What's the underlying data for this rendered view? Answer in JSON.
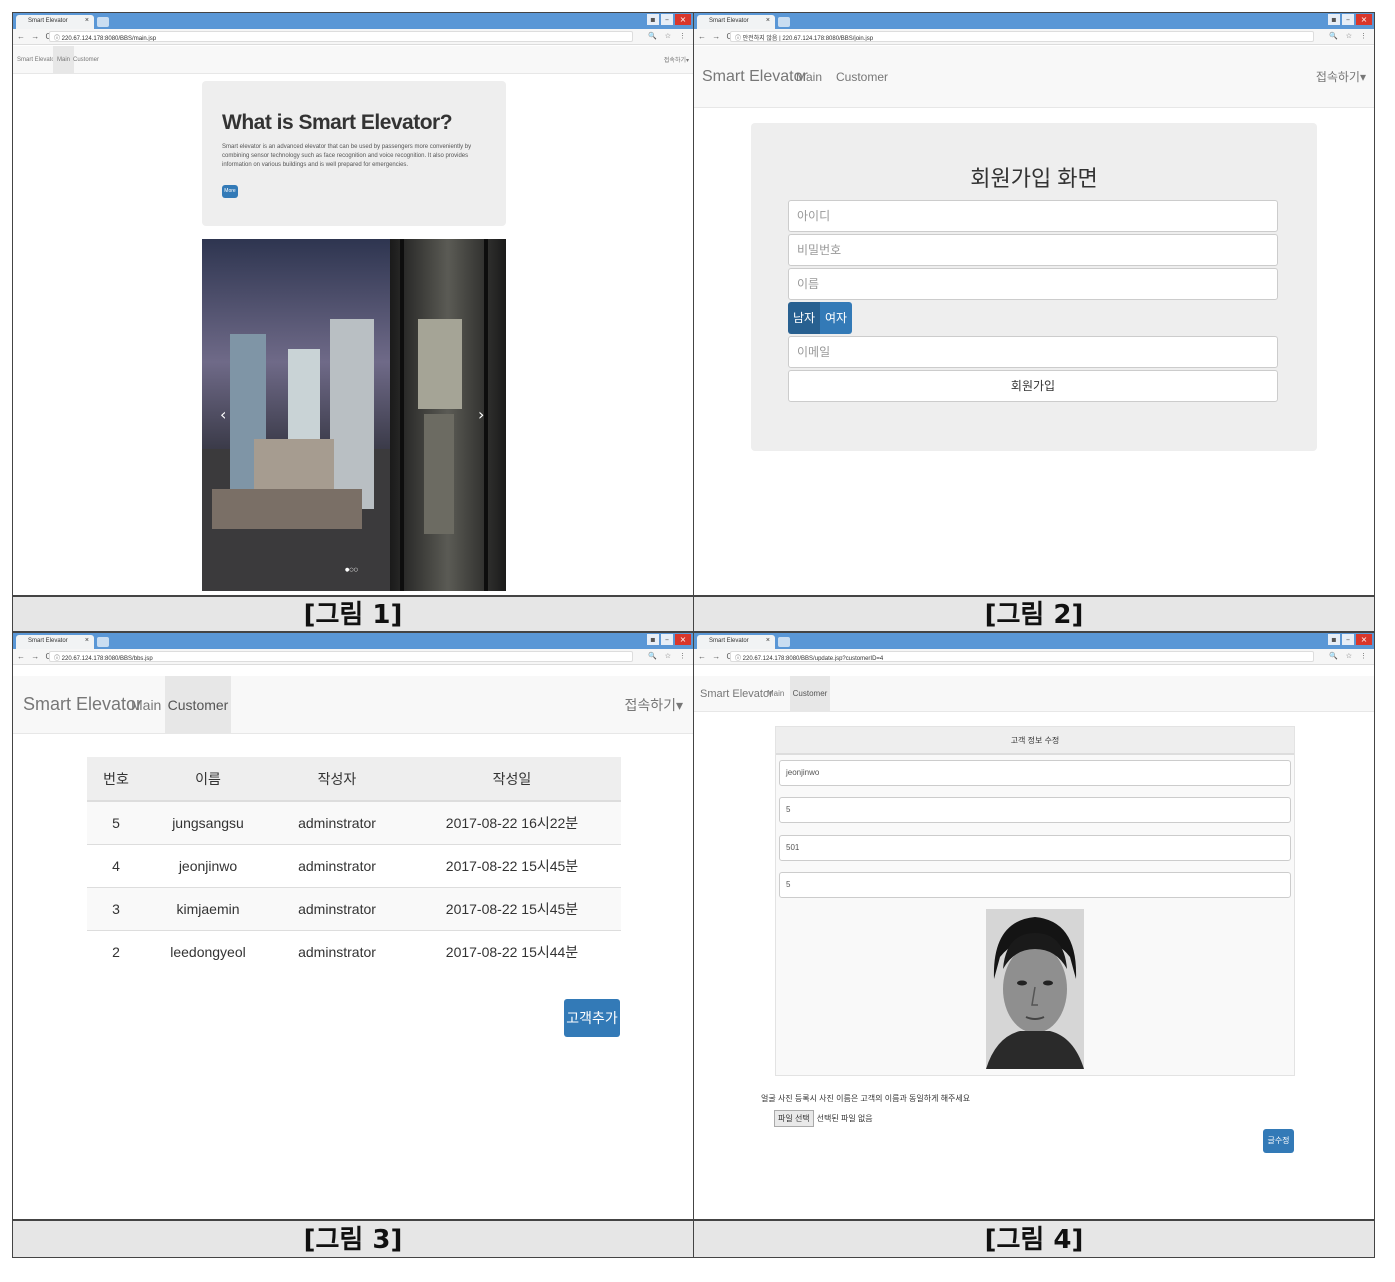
{
  "captions": [
    "[그림 1]",
    "[그림 2]",
    "[그림 3]",
    "[그림 4]"
  ],
  "browser": {
    "tab_title": "Smart Elevator",
    "tab_close": "×",
    "nav": "← → C",
    "urls": [
      "ⓘ 220.67.124.178:8080/BBS/main.jsp",
      "ⓘ 안전하지 않음 | 220.67.124.178:8080/BBS/join.jsp",
      "ⓘ 220.67.124.178:8080/BBS/bbs.jsp",
      "ⓘ 220.67.124.178:8080/BBS/update.jsp?customerID=4"
    ],
    "addr_icons": "🔍 ☆ ⋮",
    "win_buttons": [
      "▪",
      "–",
      "×"
    ]
  },
  "navbar": {
    "brand": "Smart Elevator",
    "main": "Main",
    "customer": "Customer",
    "connect": "접속하기▾"
  },
  "fig1": {
    "heading": "What is Smart Elevator?",
    "text": "Smart elevator is an advanced elevator that can be used by passengers more conveniently by combining sensor technology such as face recognition and voice recognition. It also provides information on various buildings and is well prepared for emergencies.",
    "more": "More",
    "carousel_prev": "‹",
    "carousel_next": "›",
    "carousel_dots": "●○○"
  },
  "fig2": {
    "title": "회원가입 화면",
    "id_placeholder": "아이디",
    "pw_placeholder": "비밀번호",
    "name_placeholder": "이름",
    "male": "남자",
    "female": "여자",
    "email_placeholder": "이메일",
    "submit": "회원가입"
  },
  "fig3": {
    "headers": [
      "번호",
      "이름",
      "작성자",
      "작성일"
    ],
    "rows": [
      [
        "5",
        "jungsangsu",
        "adminstrator",
        "2017-08-22 16시22분"
      ],
      [
        "4",
        "jeonjinwo",
        "adminstrator",
        "2017-08-22 15시45분"
      ],
      [
        "3",
        "kimjaemin",
        "adminstrator",
        "2017-08-22 15시45분"
      ],
      [
        "2",
        "leedongyeol",
        "adminstrator",
        "2017-08-22 15시44분"
      ]
    ],
    "add_button": "고객추가"
  },
  "fig4": {
    "title": "고객 정보 수정",
    "fields": [
      "jeonjinwo",
      "5",
      "501",
      "5"
    ],
    "notice": "얼굴 사진 등록시 사진 이름은 고객의 이름과 동일하게 해주세요",
    "file_button": "파일 선택",
    "file_status": "선택된 파일 없음",
    "submit": "글수정"
  },
  "colors": {
    "primary": "#337ab7",
    "chrome_blue": "#5a97d6",
    "jumbotron": "#eeeeee"
  }
}
